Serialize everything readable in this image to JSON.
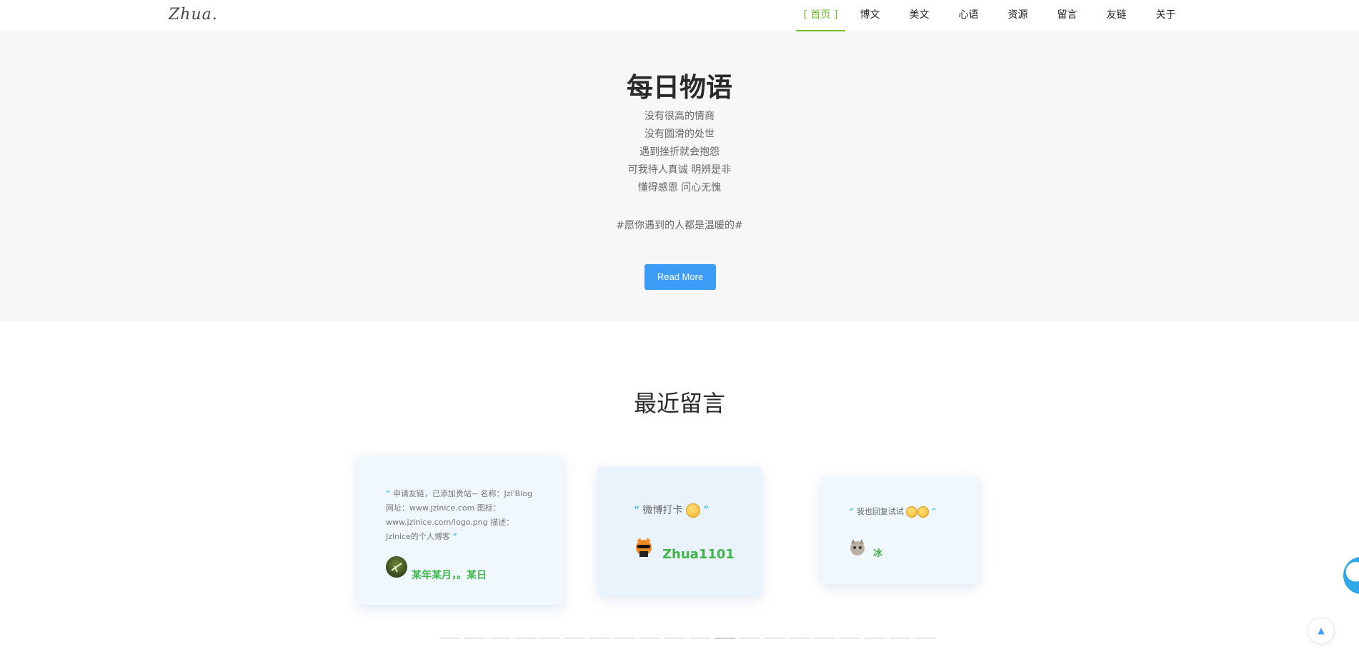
{
  "header": {
    "logo": "Zhua.",
    "nav": [
      {
        "label": "[ 首页 ]",
        "active": true
      },
      {
        "label": "博文",
        "active": false
      },
      {
        "label": "美文",
        "active": false
      },
      {
        "label": "心语",
        "active": false
      },
      {
        "label": "资源",
        "active": false
      },
      {
        "label": "留言",
        "active": false
      },
      {
        "label": "友链",
        "active": false
      },
      {
        "label": "关于",
        "active": false
      }
    ]
  },
  "hero": {
    "title": "每日物语",
    "lines": [
      "没有很高的情商",
      "没有圆滑的处世",
      "遇到挫折就会抱怨",
      "可我待人真诚 明辨是非",
      "懂得感恩 问心无愧"
    ],
    "tag": "#愿你遇到的人都是温暖的#",
    "button": "Read More"
  },
  "comments": {
    "title": "最近留言",
    "items": [
      {
        "text": "申请友链，已添加贵站~ 名称：Jzl'Blog 网址：www.jzlnice.com 图标：www.jzlnice.com/logo.png 描述：Jzlnice的个人博客",
        "author": "某年某月，。某日"
      },
      {
        "text": "微博打卡",
        "author": "Zhua1101"
      },
      {
        "text": "我也回复试试",
        "author": "冰"
      }
    ]
  },
  "pager": {
    "count": 20,
    "active_index": 11
  },
  "theme": {
    "accent": "#6fbf2a",
    "button": "#3d9cf5",
    "author": "#3fb54a",
    "quote": "#2ec4e6"
  }
}
